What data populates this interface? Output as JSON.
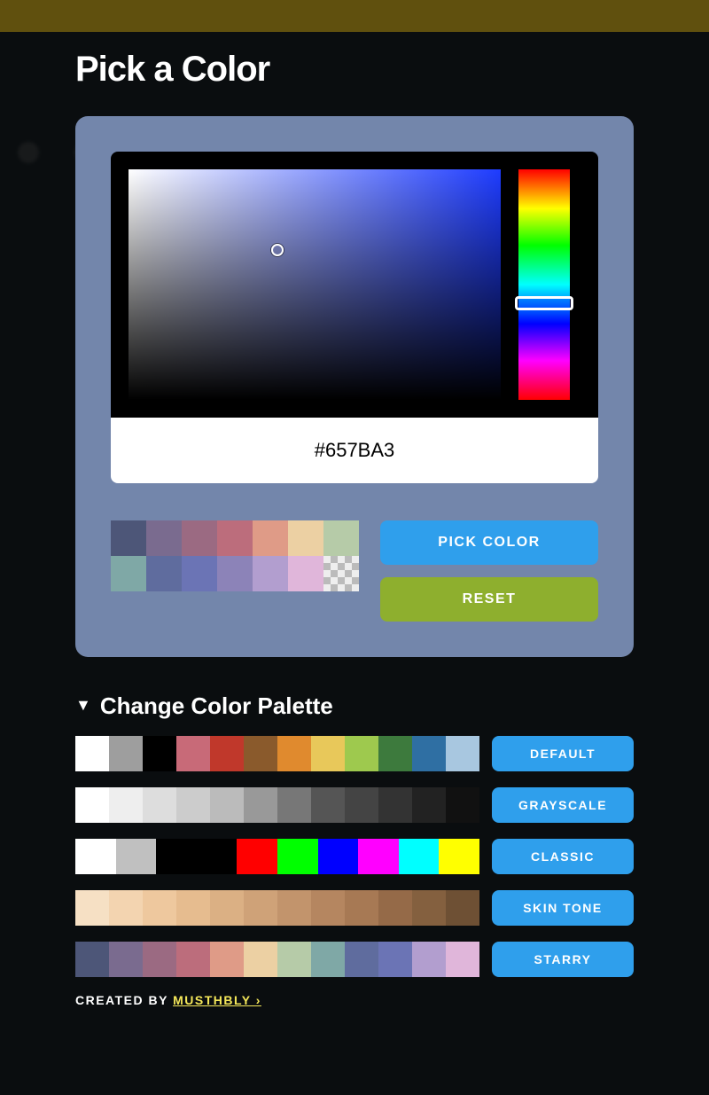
{
  "title": "Pick a Color",
  "picker": {
    "hex": "#657BA3",
    "pick_label": "PICK COLOR",
    "reset_label": "RESET",
    "swatches_row1": [
      "#4d5678",
      "#7a6b8f",
      "#9b6a82",
      "#bc6d7c",
      "#df9b87",
      "#ecd0a3",
      "#b6cba8"
    ],
    "swatches_row2": [
      "#7fa8a6",
      "#5f6c9e",
      "#6b74b5",
      "#8c83b8",
      "#b29ecf",
      "#e0b6da",
      "transparent"
    ]
  },
  "palette_section": {
    "title": "Change Color Palette",
    "rows": [
      {
        "label": "DEFAULT",
        "colors": [
          "#ffffff",
          "#9e9e9e",
          "#000000",
          "#c86a78",
          "#c0382b",
          "#8a5a2c",
          "#e08a2e",
          "#e8c85a",
          "#9ec94e",
          "#3d7a3d",
          "#2f6fa3",
          "#a8c7e0"
        ]
      },
      {
        "label": "GRAYSCALE",
        "colors": [
          "#ffffff",
          "#eeeeee",
          "#dddddd",
          "#cccccc",
          "#bbbbbb",
          "#999999",
          "#777777",
          "#555555",
          "#444444",
          "#333333",
          "#222222",
          "#111111"
        ]
      },
      {
        "label": "CLASSIC",
        "colors": [
          "#ffffff",
          "#c0c0c0",
          "#000000",
          "#000000",
          "#ff0000",
          "#00ff00",
          "#0000ff",
          "#ff00ff",
          "#00ffff",
          "#ffff00"
        ]
      },
      {
        "label": "SKIN TONE",
        "colors": [
          "#f6e0c4",
          "#f3d4b0",
          "#eec89e",
          "#e6bc8f",
          "#dbb084",
          "#cfa278",
          "#c2946c",
          "#b58660",
          "#a77954",
          "#956a48",
          "#84603f",
          "#6e5034"
        ]
      },
      {
        "label": "STARRY",
        "colors": [
          "#4d5678",
          "#7a6b8f",
          "#9b6a82",
          "#bc6d7c",
          "#df9b87",
          "#ecd0a3",
          "#b6cba8",
          "#7fa8a6",
          "#5f6c9e",
          "#6b74b5",
          "#b29ecf",
          "#e0b6da"
        ]
      }
    ]
  },
  "credit": {
    "prefix": "CREATED BY ",
    "author": "MUSTHBLY ›"
  }
}
